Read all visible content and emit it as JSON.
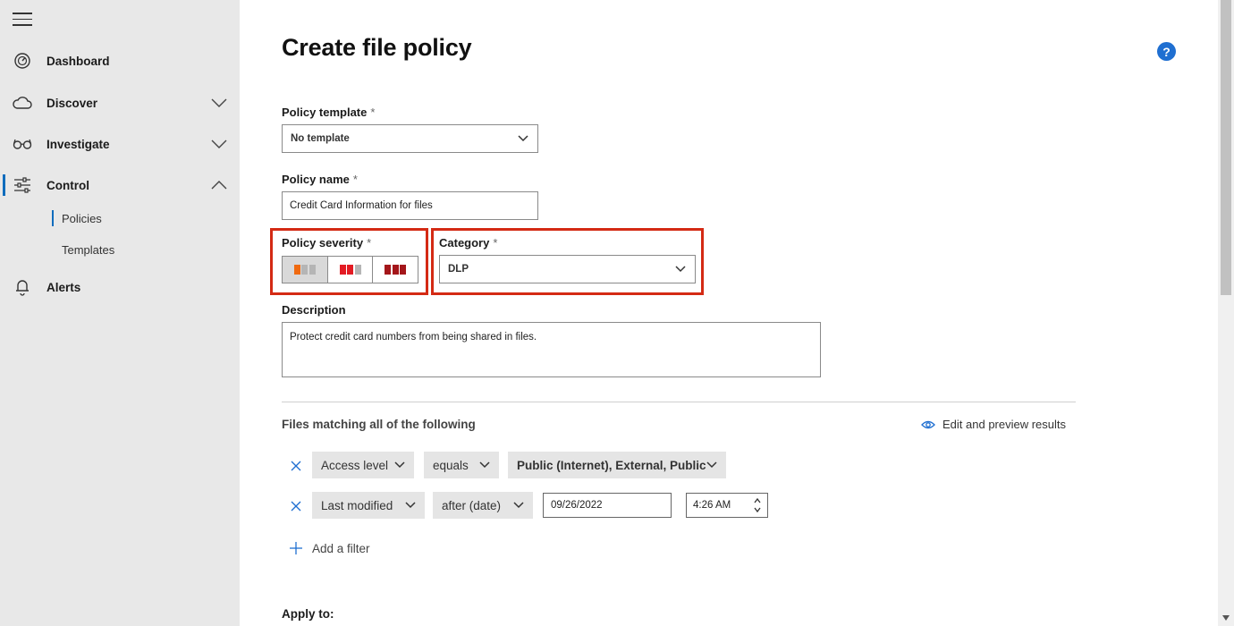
{
  "sidebar": {
    "items": [
      {
        "label": "Dashboard",
        "icon": "gauge-icon"
      },
      {
        "label": "Discover",
        "icon": "cloud-icon"
      },
      {
        "label": "Investigate",
        "icon": "glasses-icon"
      },
      {
        "label": "Control",
        "icon": "sliders-icon"
      },
      {
        "label": "Alerts",
        "icon": "bell-icon"
      }
    ],
    "control_subitems": [
      {
        "label": "Policies",
        "active": true
      },
      {
        "label": "Templates",
        "active": false
      }
    ]
  },
  "page": {
    "title": "Create file policy",
    "help_glyph": "?"
  },
  "form": {
    "template": {
      "label": "Policy template",
      "required_mark": "*",
      "value": "No template"
    },
    "name": {
      "label": "Policy name",
      "required_mark": "*",
      "value": "Credit Card Information for files"
    },
    "severity": {
      "label": "Policy severity",
      "required_mark": "*",
      "options": [
        "low",
        "medium",
        "high"
      ],
      "selected": "low"
    },
    "category": {
      "label": "Category",
      "required_mark": "*",
      "value": "DLP"
    },
    "description": {
      "label": "Description",
      "value": "Protect credit card numbers from being shared in files."
    }
  },
  "filters": {
    "title": "Files matching all of the following",
    "edit_preview_label": "Edit and preview results",
    "rows": [
      {
        "field": "Access level",
        "operator": "equals",
        "value": "Public (Internet), External, Public"
      },
      {
        "field": "Last modified",
        "operator": "after (date)",
        "date": "09/26/2022",
        "time": "4:26 AM"
      }
    ],
    "add_filter_label": "Add a filter"
  },
  "apply_to": {
    "label": "Apply to:"
  },
  "colors": {
    "highlight": "#d42a14",
    "accent_blue": "#1f6fd1",
    "severity_low": "#f06a10",
    "severity_medium": "#e31b23",
    "severity_high": "#a4161a"
  }
}
